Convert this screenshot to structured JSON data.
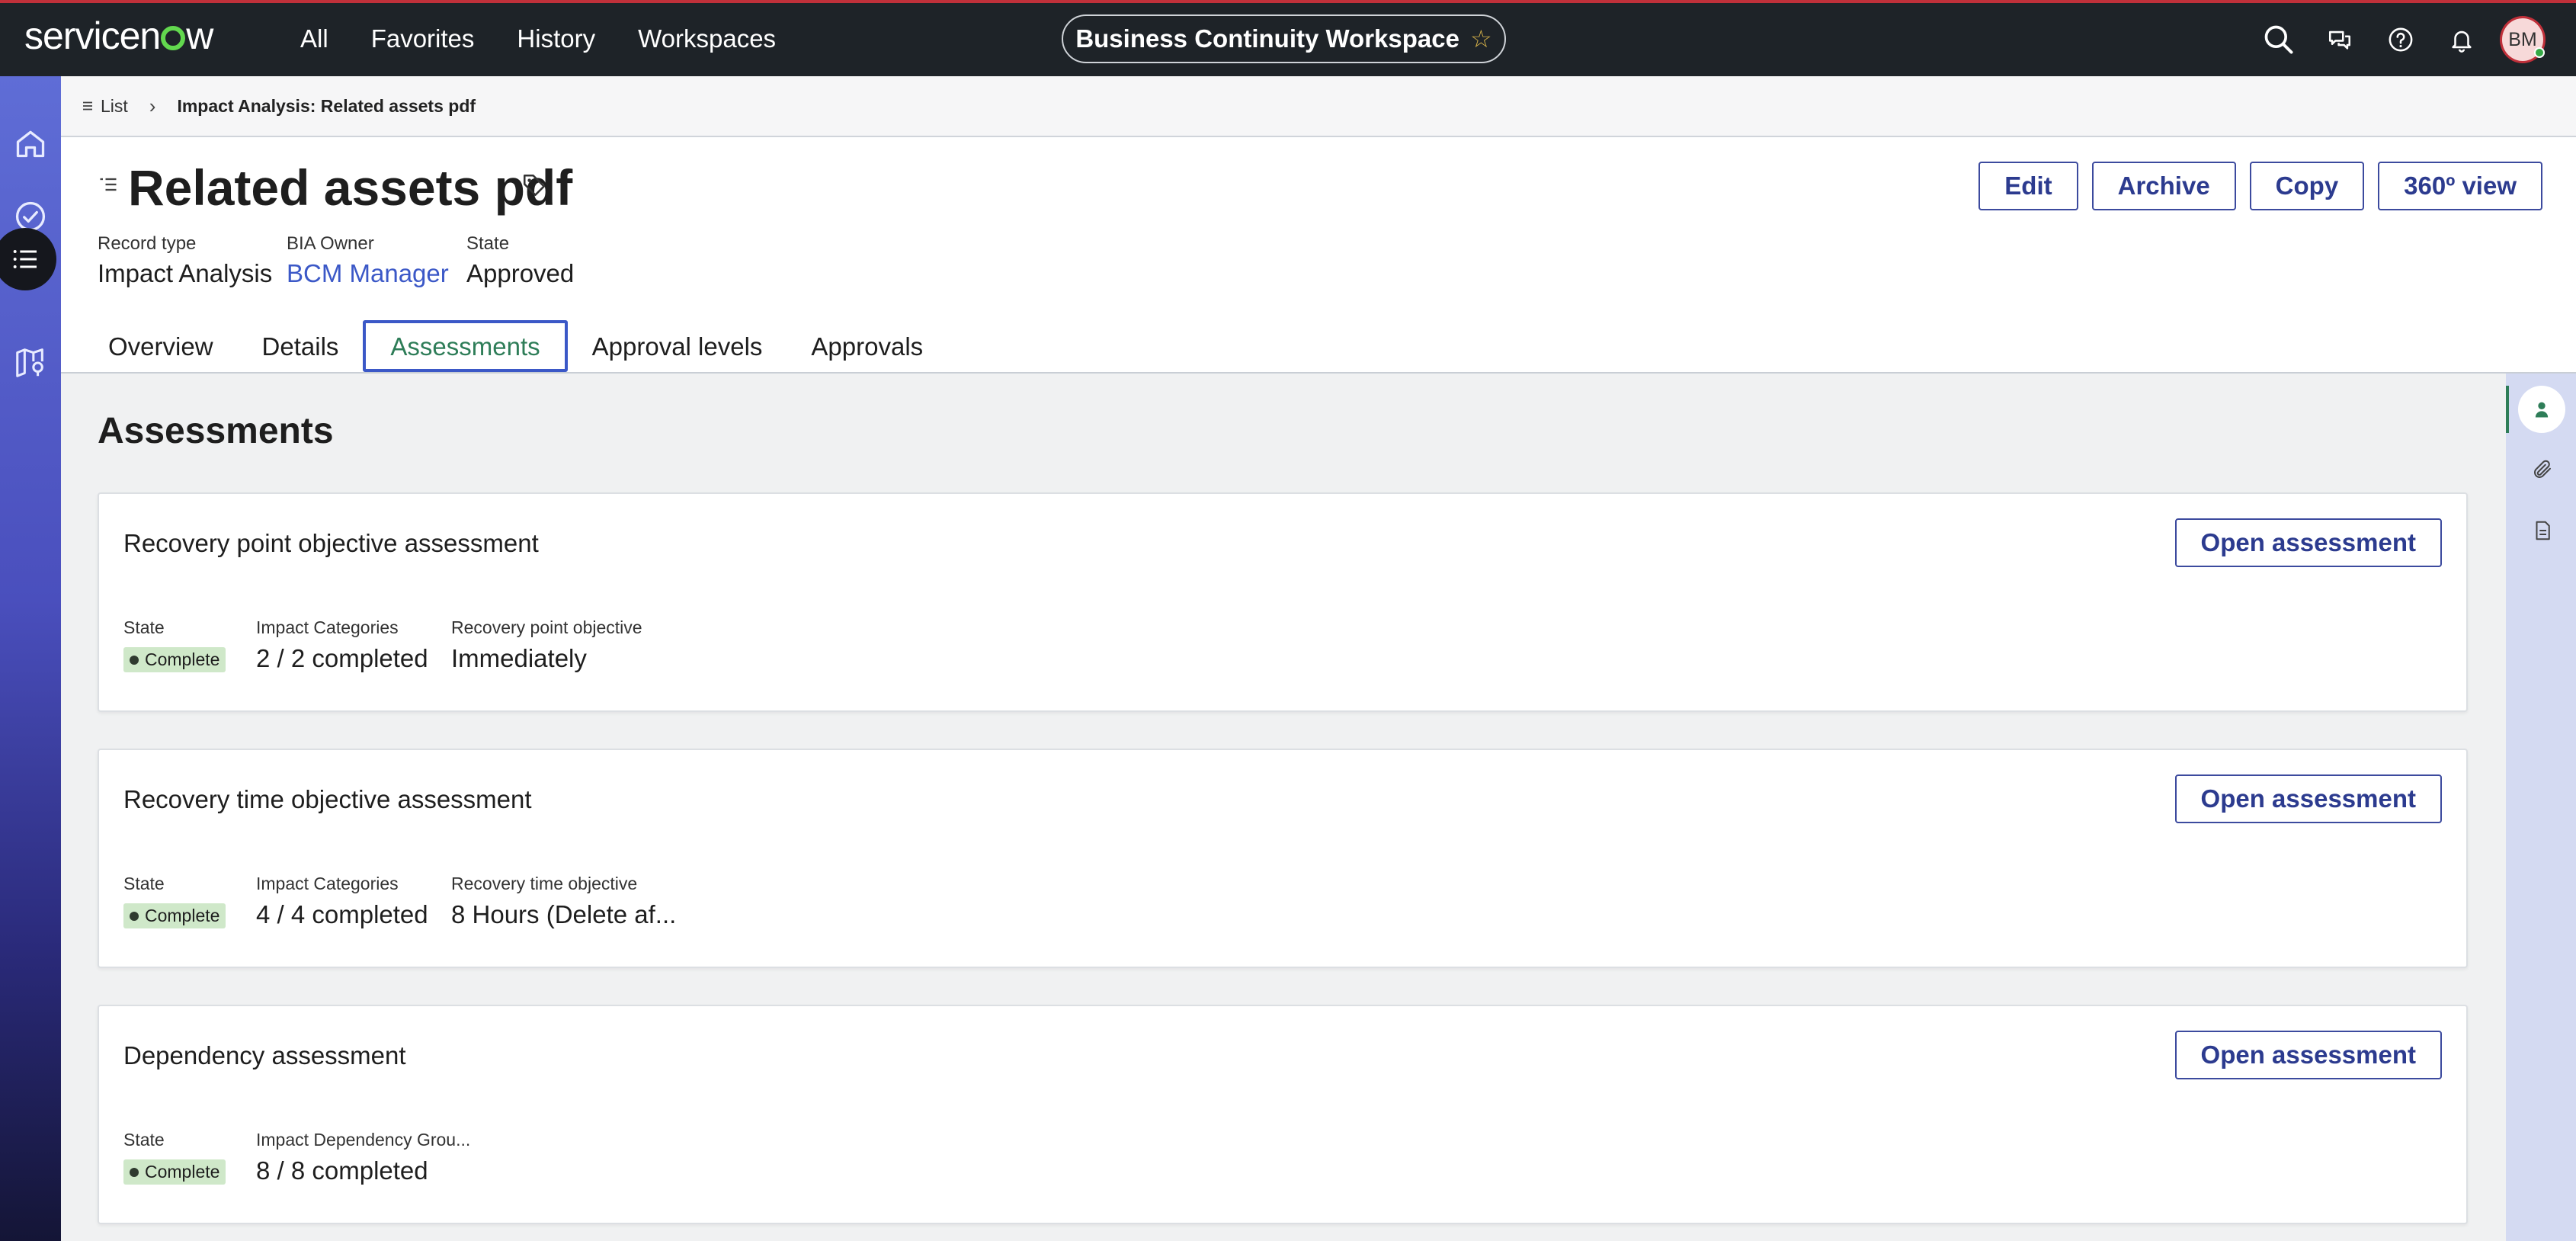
{
  "topnav": {
    "logo_pre": "servicen",
    "logo_post": "w",
    "menu": [
      "All",
      "Favorites",
      "History",
      "Workspaces"
    ],
    "workspace_label": "Business Continuity Workspace",
    "avatar_initials": "BM",
    "icons": [
      "search-icon",
      "chat-icon",
      "help-icon",
      "bell-icon"
    ]
  },
  "leftrail": {
    "icons": [
      "home-icon",
      "check-circle-icon",
      "list-icon",
      "map-icon"
    ],
    "active_index": 2
  },
  "breadcrumb": {
    "list_label": "List",
    "current": "Impact Analysis: Related assets pdf"
  },
  "record": {
    "title": "Related assets pdf",
    "meta": [
      {
        "label": "Record type",
        "value": "Impact Analysis"
      },
      {
        "label": "BIA Owner",
        "value": "BCM Manager"
      },
      {
        "label": "State",
        "value": "Approved"
      }
    ],
    "actions": [
      "Edit",
      "Archive",
      "Copy",
      "360º view"
    ]
  },
  "tabs": [
    "Overview",
    "Details",
    "Assessments",
    "Approval levels",
    "Approvals"
  ],
  "active_tab": "Assessments",
  "assessments": {
    "section_title": "Assessments",
    "open_label": "Open assessment",
    "cards": [
      {
        "title": "Recovery point objective assessment",
        "state_label": "State",
        "state_value": "Complete",
        "fields": [
          {
            "label": "Impact Categories",
            "value": "2 / 2 completed"
          },
          {
            "label": "Recovery point objective",
            "value": "Immediately"
          }
        ]
      },
      {
        "title": "Recovery time objective assessment",
        "state_label": "State",
        "state_value": "Complete",
        "fields": [
          {
            "label": "Impact Categories",
            "value": "4 / 4 completed"
          },
          {
            "label": "Recovery time objective",
            "value": "8 Hours (Delete af..."
          }
        ]
      },
      {
        "title": "Dependency assessment",
        "state_label": "State",
        "state_value": "Complete",
        "fields": [
          {
            "label": "Impact Dependency Grou...",
            "value": "8 / 8 completed"
          }
        ]
      }
    ]
  },
  "rightrail": {
    "icons": [
      "person-icon",
      "paperclip-icon",
      "document-icon"
    ],
    "active_index": 0
  },
  "colors": {
    "nav_bg": "#1e2328",
    "accent_blue": "#3b58c7",
    "button_text": "#2c3b8f",
    "complete_badge": "#cfe8c9",
    "active_tab_text": "#2e7d58",
    "logo_green": "#62d84e"
  }
}
